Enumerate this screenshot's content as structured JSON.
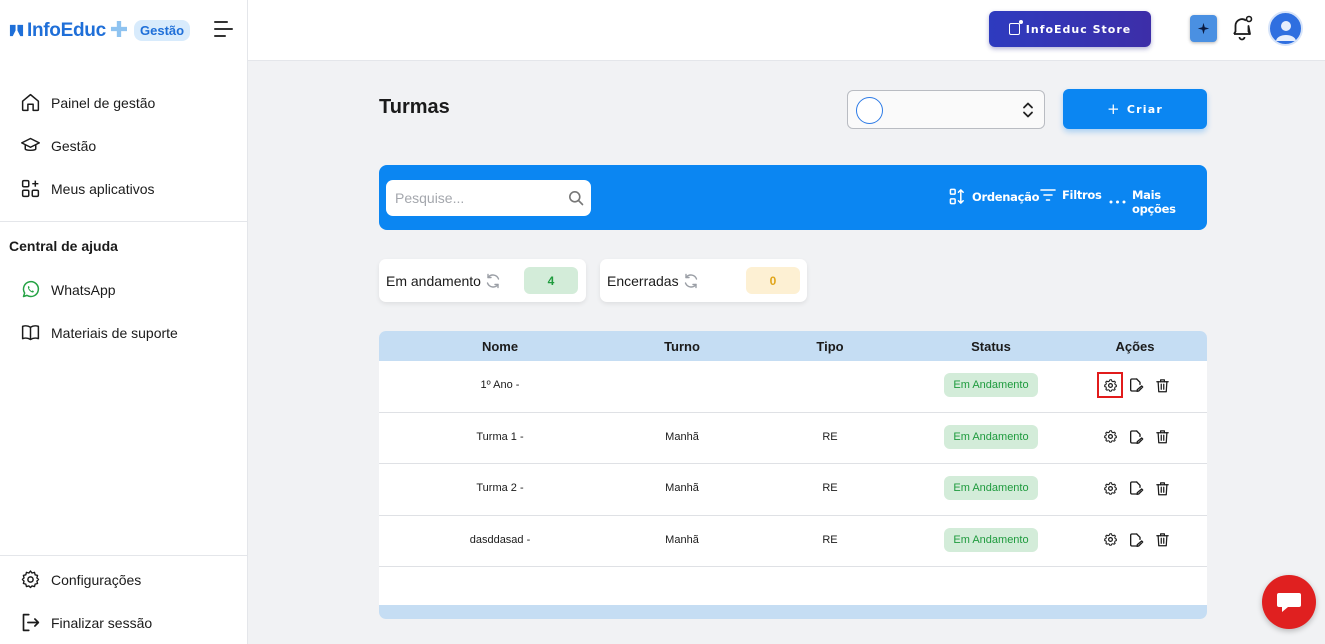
{
  "brand": {
    "logo_text": "InfoEduc",
    "badge": "Gestão"
  },
  "sidebar": {
    "items": [
      {
        "label": "Painel de gestão",
        "icon": "home-icon"
      },
      {
        "label": "Gestão",
        "icon": "graduation-cap-icon"
      },
      {
        "label": "Meus aplicativos",
        "icon": "apps-icon"
      }
    ],
    "help_title": "Central de ajuda",
    "help_items": [
      {
        "label": "WhatsApp",
        "icon": "whatsapp-icon"
      },
      {
        "label": "Materiais de suporte",
        "icon": "book-icon"
      }
    ],
    "bottom_items": [
      {
        "label": "Configurações",
        "icon": "gear-icon"
      },
      {
        "label": "Finalizar sessão",
        "icon": "logout-icon"
      }
    ]
  },
  "header": {
    "store_label": "InfoEduc Store"
  },
  "main": {
    "title": "Turmas",
    "create_label": "Criar",
    "search_placeholder": "Pesquise...",
    "tools": {
      "order": "Ordenação",
      "filters": "Filtros",
      "more": "Mais opções"
    },
    "stats": {
      "in_progress_label": "Em andamento",
      "in_progress_count": "4",
      "closed_label": "Encerradas",
      "closed_count": "0"
    },
    "table": {
      "headers": {
        "name": "Nome",
        "turno": "Turno",
        "tipo": "Tipo",
        "status": "Status",
        "acoes": "Ações"
      },
      "rows": [
        {
          "name": "1º Ano -",
          "turno": "",
          "tipo": "",
          "status": "Em Andamento"
        },
        {
          "name": "Turma 1 -",
          "turno": "Manhã",
          "tipo": "RE",
          "status": "Em Andamento"
        },
        {
          "name": "Turma 2 -",
          "turno": "Manhã",
          "tipo": "RE",
          "status": "Em Andamento"
        },
        {
          "name": "dasddasad -",
          "turno": "Manhã",
          "tipo": "RE",
          "status": "Em Andamento"
        }
      ]
    }
  },
  "colors": {
    "primary": "#0b86f2",
    "store_gradient_start": "#2e3bbf",
    "status_green": "#1f9b3e",
    "closed_amber": "#e0a51a",
    "chat_red": "#e02020",
    "highlight_red": "#e11b1b"
  }
}
